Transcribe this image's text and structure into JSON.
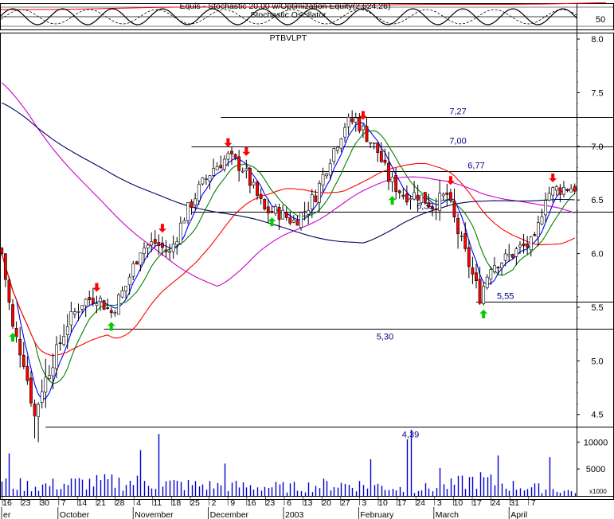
{
  "header": {
    "indicator_title": "Equis - Stochastic 20.00 w/Optimization Equity(2,624.26)",
    "oscillator_title": "Stochastic Oscillator",
    "oscillator_level": "50"
  },
  "chart_data": {
    "type": "candlestick",
    "symbol": "PTBVLPT",
    "price_ticks": [
      "8.0",
      "7.5",
      "7.0",
      "6.5",
      "6.0",
      "5.5",
      "5.0",
      "4.5"
    ],
    "price_tick_values": [
      8.0,
      7.5,
      7.0,
      6.5,
      6.0,
      5.5,
      5.0,
      4.5
    ],
    "ylim": [
      4.32,
      8.06
    ],
    "volume_ticks": [
      "10000",
      "5000"
    ],
    "volume_tick_values": [
      10000,
      5000
    ],
    "volume_unit": "x1000",
    "volume_ylim": [
      0,
      13000
    ],
    "grid": false,
    "date_ticks": [
      "16",
      "23",
      "30",
      "7",
      "14",
      "21",
      "28",
      "4",
      "11",
      "18",
      "25",
      "2",
      "9",
      "16",
      "23",
      "6",
      "13",
      "20",
      "27",
      "3",
      "10",
      "17",
      "24",
      "3",
      "10",
      "17",
      "24",
      "31",
      "7"
    ],
    "month_labels": [
      {
        "label": "er",
        "at": 0
      },
      {
        "label": "October",
        "at": 3
      },
      {
        "label": "November",
        "at": 7
      },
      {
        "label": "December",
        "at": 11
      },
      {
        "label": "2003",
        "at": 15
      },
      {
        "label": "February",
        "at": 19
      },
      {
        "label": "March",
        "at": 23
      },
      {
        "label": "April",
        "at": 27
      }
    ],
    "levels": [
      {
        "label": "7,27",
        "value": 7.27,
        "from": 60,
        "to": 170,
        "label_at": 125
      },
      {
        "label": "7,00",
        "value": 7.0,
        "from": 52,
        "to": 170,
        "label_at": 125
      },
      {
        "label": "6,77",
        "value": 6.77,
        "from": 70,
        "to": 170,
        "label_at": 130
      },
      {
        "label": "6,39",
        "value": 6.39,
        "from": 52,
        "to": 170,
        "label_at": 116
      },
      {
        "label": "5,55",
        "value": 5.55,
        "from": 130,
        "to": 170,
        "label_at": 138
      },
      {
        "label": "5,30",
        "value": 5.3,
        "from": 28,
        "to": 170,
        "label_at": 105
      },
      {
        "label": "4,39",
        "value": 4.39,
        "from": 12,
        "to": 170,
        "label_at": 112
      }
    ],
    "sell_signals": [
      26,
      44,
      62,
      67,
      99,
      123,
      151
    ],
    "buy_signals": [
      3,
      30,
      74,
      107,
      132
    ],
    "series_smoothing": [
      {
        "name": "",
        "period": 5,
        "color": "#0000ff"
      },
      {
        "name": "",
        "period": 10,
        "color": "#008000"
      },
      {
        "name": "",
        "period": 30,
        "color": "#ff0000"
      },
      {
        "name": "",
        "period": 60,
        "color": "#cc00cc"
      },
      {
        "name": "",
        "period": 100,
        "color": "#000060"
      }
    ],
    "series_start_values": {
      "ma60": 7.62,
      "ma100": 7.42
    },
    "close_path": [
      [
        0,
        6.0
      ],
      [
        3,
        5.3
      ],
      [
        6,
        5.0
      ],
      [
        9,
        4.48
      ],
      [
        11,
        4.75
      ],
      [
        14,
        5.0
      ],
      [
        18,
        5.35
      ],
      [
        22,
        5.55
      ],
      [
        26,
        5.6
      ],
      [
        30,
        5.45
      ],
      [
        34,
        5.7
      ],
      [
        38,
        6.05
      ],
      [
        42,
        6.1
      ],
      [
        46,
        6.0
      ],
      [
        50,
        6.35
      ],
      [
        54,
        6.6
      ],
      [
        58,
        6.8
      ],
      [
        62,
        6.9
      ],
      [
        66,
        6.8
      ],
      [
        69,
        6.6
      ],
      [
        72,
        6.4
      ],
      [
        76,
        6.38
      ],
      [
        80,
        6.3
      ],
      [
        83,
        6.4
      ],
      [
        86,
        6.55
      ],
      [
        90,
        6.9
      ],
      [
        94,
        7.2
      ],
      [
        97,
        7.25
      ],
      [
        100,
        7.1
      ],
      [
        103,
        6.95
      ],
      [
        106,
        6.7
      ],
      [
        110,
        6.55
      ],
      [
        114,
        6.55
      ],
      [
        118,
        6.45
      ],
      [
        122,
        6.55
      ],
      [
        125,
        6.2
      ],
      [
        128,
        5.9
      ],
      [
        131,
        5.6
      ],
      [
        134,
        5.9
      ],
      [
        138,
        5.95
      ],
      [
        142,
        6.05
      ],
      [
        146,
        6.1
      ],
      [
        149,
        6.55
      ],
      [
        152,
        6.6
      ],
      [
        156,
        6.62
      ]
    ],
    "range_path": [
      [
        0,
        0.12
      ],
      [
        8,
        0.25
      ],
      [
        9,
        0.45
      ],
      [
        20,
        0.18
      ],
      [
        50,
        0.15
      ],
      [
        62,
        0.18
      ],
      [
        90,
        0.15
      ],
      [
        125,
        0.25
      ],
      [
        130,
        0.2
      ],
      [
        150,
        0.15
      ],
      [
        156,
        0.12
      ]
    ],
    "volume_path": [
      [
        0,
        2600
      ],
      [
        10,
        2200
      ],
      [
        20,
        2800
      ],
      [
        30,
        3000
      ],
      [
        40,
        3000
      ],
      [
        50,
        2400
      ],
      [
        60,
        2200
      ],
      [
        70,
        2000
      ],
      [
        80,
        1900
      ],
      [
        90,
        2500
      ],
      [
        100,
        2400
      ],
      [
        110,
        1600
      ],
      [
        120,
        1800
      ],
      [
        130,
        3600
      ],
      [
        140,
        2200
      ],
      [
        150,
        1500
      ],
      [
        156,
        1000
      ]
    ],
    "volume_spikes": [
      {
        "bar": 2,
        "value": 7900
      },
      {
        "bar": 38,
        "value": 8500
      },
      {
        "bar": 43,
        "value": 11500
      },
      {
        "bar": 61,
        "value": 6000
      },
      {
        "bar": 101,
        "value": 6800
      },
      {
        "bar": 111,
        "value": 10500
      },
      {
        "bar": 112,
        "value": 12300
      },
      {
        "bar": 120,
        "value": 5200
      },
      {
        "bar": 136,
        "value": 7500
      },
      {
        "bar": 150,
        "value": 7200
      }
    ],
    "stoch_periods": [
      10,
      13.5
    ],
    "colors": {
      "up": "#ffffff",
      "down": "#ff0000",
      "outline": "#000000",
      "volume": "#0000cc",
      "level": "#000080",
      "level_label": "#000080",
      "sell": "#ff0000",
      "buy": "#00cc00",
      "equity": "#ff0000",
      "frame": "#000000"
    }
  }
}
